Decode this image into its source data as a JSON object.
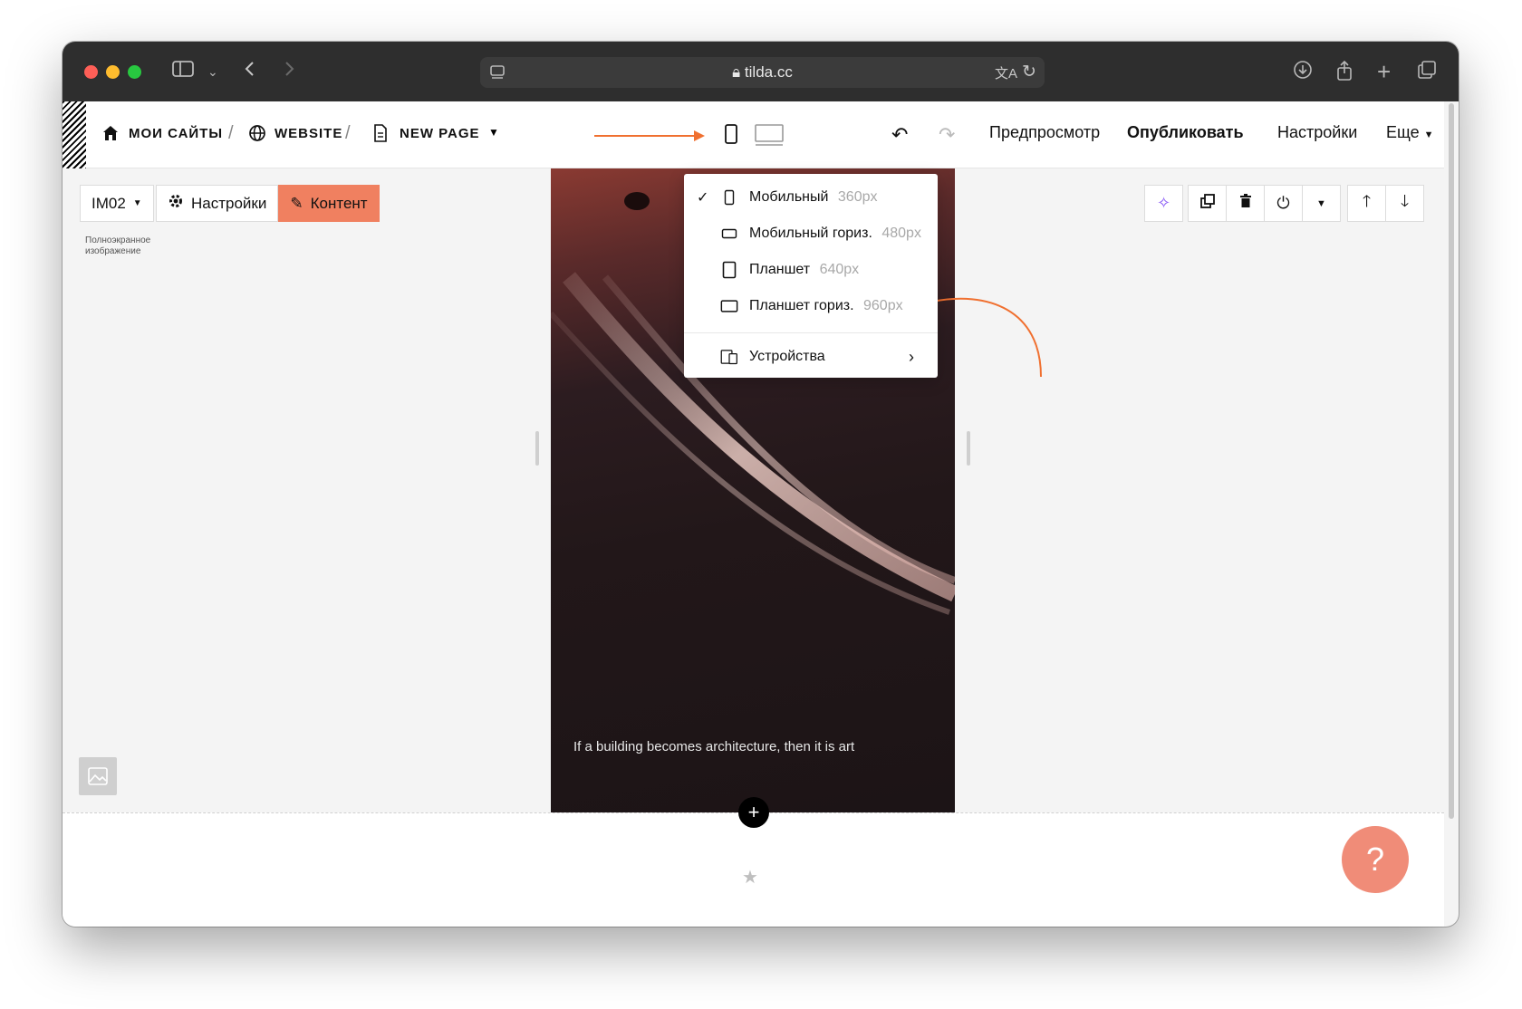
{
  "browser": {
    "url": "tilda.cc"
  },
  "header": {
    "breadcrumb_home": "МОИ САЙТЫ",
    "breadcrumb_site": "WEBSITE",
    "breadcrumb_page": "NEW PAGE",
    "preview": "Предпросмотр",
    "publish": "Опубликовать",
    "settings": "Настройки",
    "more": "Еще"
  },
  "block": {
    "id_label": "IM02",
    "settings_label": "Настройки",
    "content_label": "Контент",
    "type_label": "Полноэкранное изображение"
  },
  "preview": {
    "caption": "If a building becomes architecture, then it is art",
    "add_block": "+"
  },
  "help": {
    "label": "?"
  },
  "device_menu": {
    "items": [
      {
        "label": "Мобильный",
        "size": "360px",
        "checked": true
      },
      {
        "label": "Мобильный гориз.",
        "size": "480px",
        "checked": false
      },
      {
        "label": "Планшет",
        "size": "640px",
        "checked": false
      },
      {
        "label": "Планшет гориз.",
        "size": "960px",
        "checked": false
      }
    ],
    "devices_label": "Устройства"
  },
  "colors": {
    "accent": "#f08060",
    "annotation_arrow": "#f07030",
    "help_button": "#f08c78"
  }
}
